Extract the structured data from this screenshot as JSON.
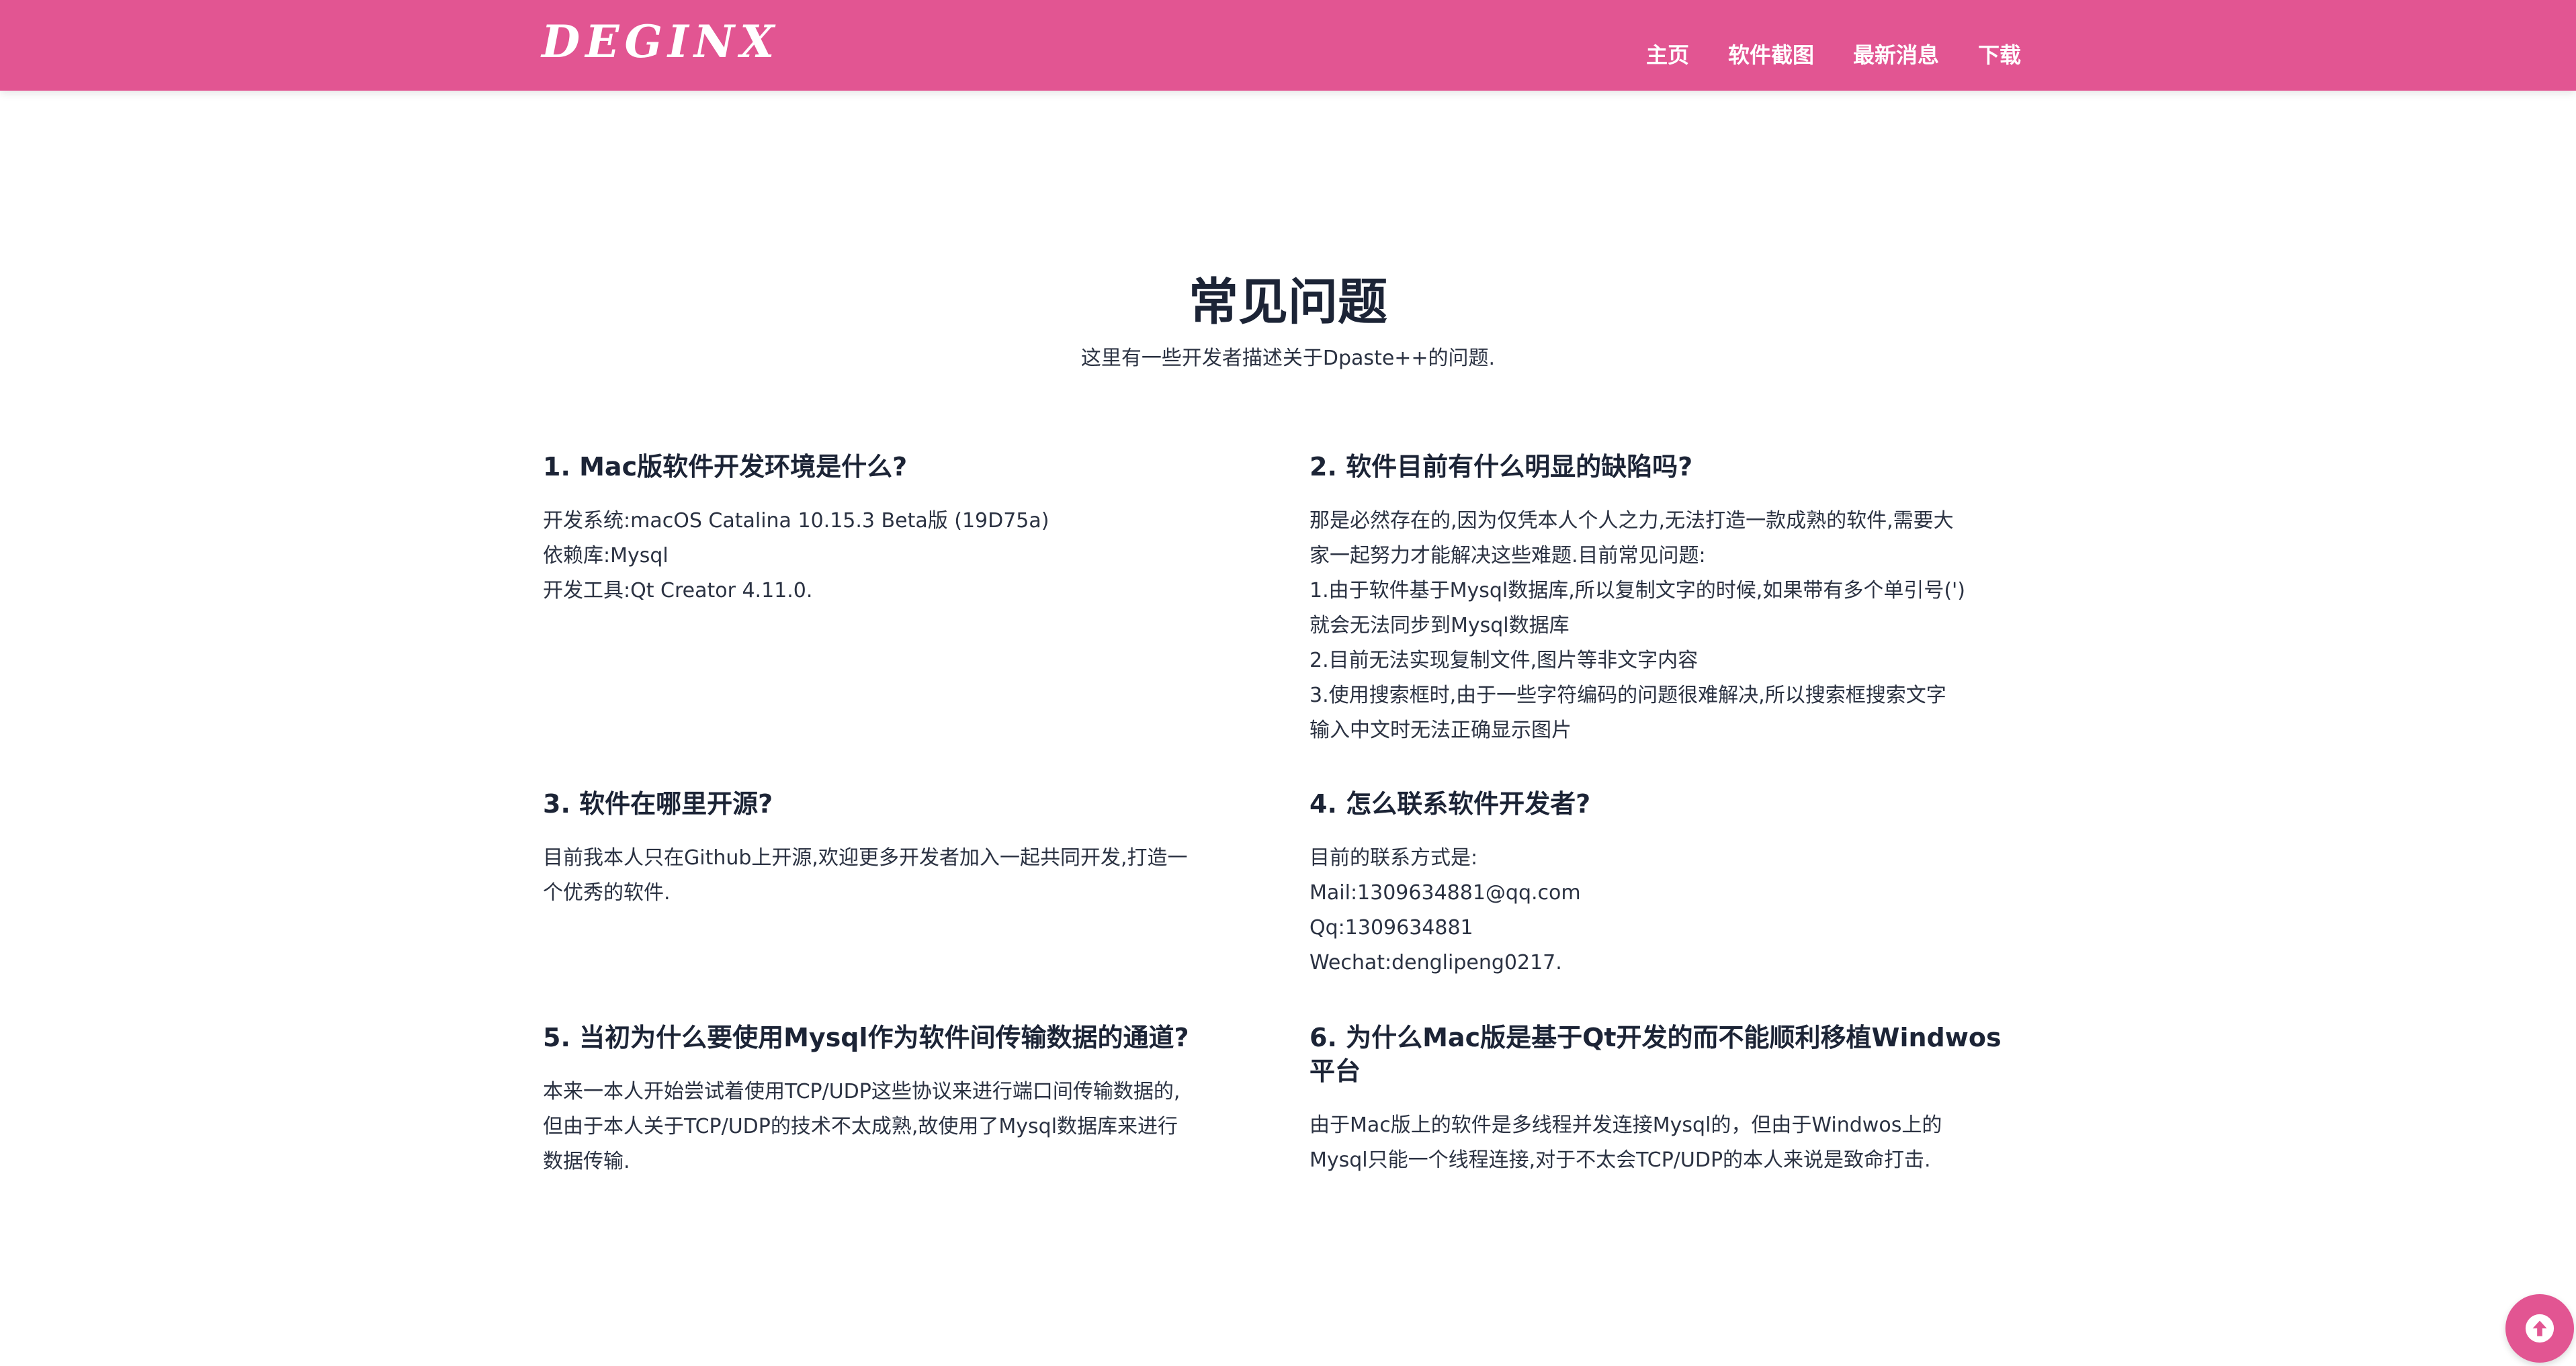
{
  "header": {
    "logo": "DEGINX",
    "nav": [
      "主页",
      "软件截图",
      "最新消息",
      "下载"
    ],
    "brand_color": "#e25592"
  },
  "section": {
    "title": "常见问题",
    "subtitle": "这里有一些开发者描述关于Dpaste++的问题."
  },
  "faqs": [
    {
      "title": "1. Mac版软件开发环境是什么?",
      "lines": [
        "开发系统:macOS Catalina 10.15.3 Beta版 (19D75a)",
        "依赖库:Mysql",
        "开发工具:Qt Creator 4.11.0."
      ]
    },
    {
      "title": "2. 软件目前有什么明显的缺陷吗?",
      "lines": [
        "那是必然存在的,因为仅凭本人个人之力,无法打造一款成熟的软件,需要大",
        "家一起努力才能解决这些难题.目前常见问题:",
        "1.由于软件基于Mysql数据库,所以复制文字的时候,如果带有多个单引号(')",
        "就会无法同步到Mysql数据库",
        "2.目前无法实现复制文件,图片等非文字内容",
        "3.使用搜索框时,由于一些字符编码的问题很难解决,所以搜索框搜索文字",
        "输入中文时无法正确显示图片"
      ]
    },
    {
      "title": "3. 软件在哪里开源?",
      "lines": [
        "目前我本人只在Github上开源,欢迎更多开发者加入一起共同开发,打造一",
        "个优秀的软件."
      ]
    },
    {
      "title": "4. 怎么联系软件开发者?",
      "lines": [
        "目前的联系方式是:",
        "Mail:1309634881@qq.com",
        "Qq:1309634881",
        "Wechat:denglipeng0217."
      ]
    },
    {
      "title": "5. 当初为什么要使用Mysql作为软件间传输数据的通道?",
      "lines": [
        "本来一本人开始尝试着使用TCP/UDP这些协议来进行端口间传输数据的,",
        "但由于本人关于TCP/UDP的技术不太成熟,故使用了Mysql数据库来进行",
        "数据传输."
      ]
    },
    {
      "title": "6. 为什么Mac版是基于Qt开发的而不能顺利移植Windwos平台",
      "lines": [
        "由于Mac版上的软件是多线程并发连接Mysql的，但由于Windwos上的",
        "Mysql只能一个线程连接,对于不太会TCP/UDP的本人来说是致命打击."
      ]
    }
  ],
  "back_to_top": {
    "icon": "arrow-up-icon"
  }
}
